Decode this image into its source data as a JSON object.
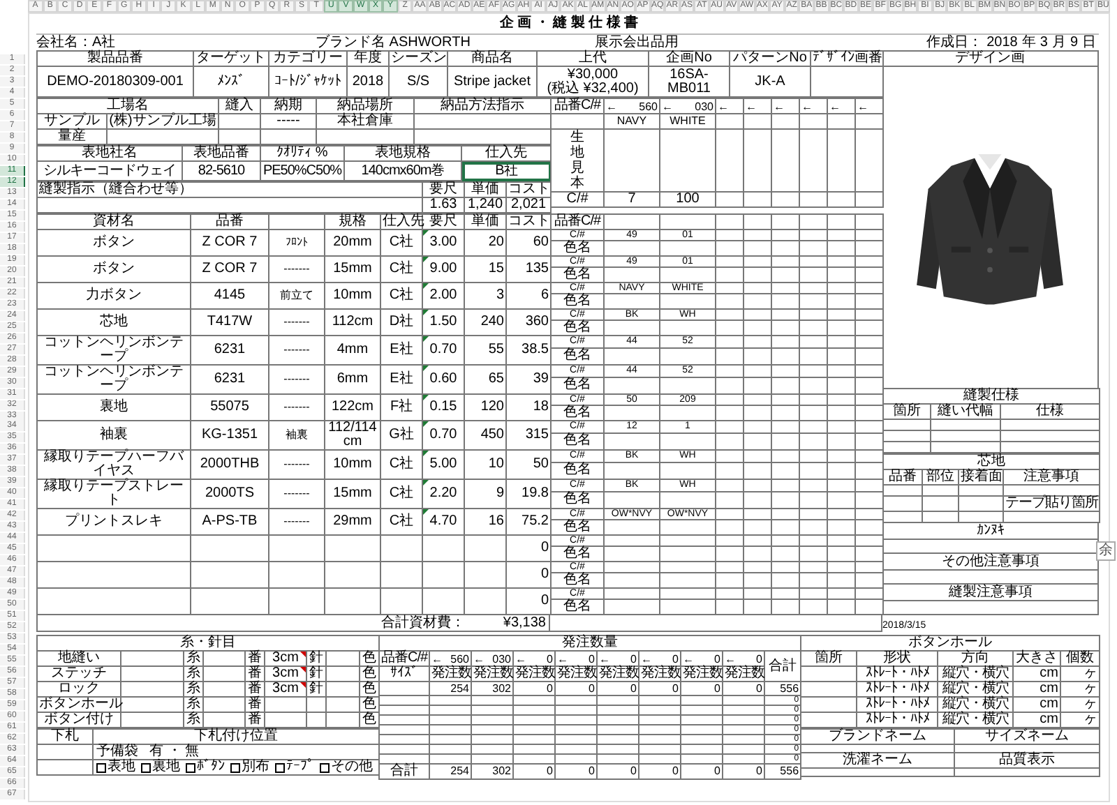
{
  "column_headers": [
    {
      "label": "A",
      "selected": false
    },
    {
      "label": "B",
      "selected": false
    },
    {
      "label": "C",
      "selected": false
    },
    {
      "label": "D",
      "selected": false
    },
    {
      "label": "E",
      "selected": false
    },
    {
      "label": "F",
      "selected": false
    },
    {
      "label": "G",
      "selected": false
    },
    {
      "label": "H",
      "selected": false
    },
    {
      "label": "I",
      "selected": false
    },
    {
      "label": "J",
      "selected": false
    },
    {
      "label": "K",
      "selected": false
    },
    {
      "label": "L",
      "selected": false
    },
    {
      "label": "M",
      "selected": false
    },
    {
      "label": "N",
      "selected": false
    },
    {
      "label": "O",
      "selected": false
    },
    {
      "label": "P",
      "selected": false
    },
    {
      "label": "Q",
      "selected": false
    },
    {
      "label": "R",
      "selected": false
    },
    {
      "label": "S",
      "selected": false
    },
    {
      "label": "T",
      "selected": false
    },
    {
      "label": "U",
      "selected": true
    },
    {
      "label": "V",
      "selected": true
    },
    {
      "label": "W",
      "selected": true
    },
    {
      "label": "X",
      "selected": true
    },
    {
      "label": "Y",
      "selected": true
    },
    {
      "label": "Z",
      "selected": false
    },
    {
      "label": "AA",
      "selected": false
    },
    {
      "label": "AB",
      "selected": false
    },
    {
      "label": "AC",
      "selected": false
    },
    {
      "label": "AD",
      "selected": false
    },
    {
      "label": "AE",
      "selected": false
    },
    {
      "label": "AF",
      "selected": false
    },
    {
      "label": "AG",
      "selected": false
    },
    {
      "label": "AH",
      "selected": false
    },
    {
      "label": "AI",
      "selected": false
    },
    {
      "label": "AJ",
      "selected": false
    },
    {
      "label": "AK",
      "selected": false
    },
    {
      "label": "AL",
      "selected": false
    },
    {
      "label": "AM",
      "selected": false
    },
    {
      "label": "AN",
      "selected": false
    },
    {
      "label": "AO",
      "selected": false
    },
    {
      "label": "AP",
      "selected": false
    },
    {
      "label": "AQ",
      "selected": false
    },
    {
      "label": "AR",
      "selected": false
    },
    {
      "label": "AS",
      "selected": false
    },
    {
      "label": "AT",
      "selected": false
    },
    {
      "label": "AU",
      "selected": false
    },
    {
      "label": "AV",
      "selected": false
    },
    {
      "label": "AW",
      "selected": false
    },
    {
      "label": "AX",
      "selected": false
    },
    {
      "label": "AY",
      "selected": false
    },
    {
      "label": "AZ",
      "selected": false
    },
    {
      "label": "BA",
      "selected": false
    },
    {
      "label": "BB",
      "selected": false
    },
    {
      "label": "BC",
      "selected": false
    },
    {
      "label": "BD",
      "selected": false
    },
    {
      "label": "BE",
      "selected": false
    },
    {
      "label": "BF",
      "selected": false
    },
    {
      "label": "BG",
      "selected": false
    },
    {
      "label": "BH",
      "selected": false
    },
    {
      "label": "BI",
      "selected": false
    },
    {
      "label": "BJ",
      "selected": false
    },
    {
      "label": "BK",
      "selected": false
    },
    {
      "label": "BL",
      "selected": false
    },
    {
      "label": "BM",
      "selected": false
    },
    {
      "label": "BN",
      "selected": false
    },
    {
      "label": "BO",
      "selected": false
    },
    {
      "label": "BP",
      "selected": false
    },
    {
      "label": "BQ",
      "selected": false
    },
    {
      "label": "BR",
      "selected": false
    },
    {
      "label": "BS",
      "selected": false
    },
    {
      "label": "BT",
      "selected": false
    },
    {
      "label": "BU",
      "selected": false
    }
  ],
  "row_headers": [
    {
      "label": "1",
      "selected": false
    },
    {
      "label": "2",
      "selected": false
    },
    {
      "label": "3",
      "selected": false
    },
    {
      "label": "4",
      "selected": false
    },
    {
      "label": "5",
      "selected": false
    },
    {
      "label": "6",
      "selected": false
    },
    {
      "label": "7",
      "selected": false
    },
    {
      "label": "8",
      "selected": false
    },
    {
      "label": "9",
      "selected": false
    },
    {
      "label": "10",
      "selected": false
    },
    {
      "label": "11",
      "selected": true
    },
    {
      "label": "12",
      "selected": true
    },
    {
      "label": "13",
      "selected": false
    },
    {
      "label": "14",
      "selected": false
    },
    {
      "label": "15",
      "selected": false
    },
    {
      "label": "16",
      "selected": false
    },
    {
      "label": "17",
      "selected": false
    },
    {
      "label": "18",
      "selected": false
    },
    {
      "label": "19",
      "selected": false
    },
    {
      "label": "20",
      "selected": false
    },
    {
      "label": "21",
      "selected": false
    },
    {
      "label": "22",
      "selected": false
    },
    {
      "label": "23",
      "selected": false
    },
    {
      "label": "24",
      "selected": false
    },
    {
      "label": "25",
      "selected": false
    },
    {
      "label": "26",
      "selected": false
    },
    {
      "label": "27",
      "selected": false
    },
    {
      "label": "28",
      "selected": false
    },
    {
      "label": "29",
      "selected": false
    },
    {
      "label": "30",
      "selected": false
    },
    {
      "label": "31",
      "selected": false
    },
    {
      "label": "32",
      "selected": false
    },
    {
      "label": "33",
      "selected": false
    },
    {
      "label": "34",
      "selected": false
    },
    {
      "label": "35",
      "selected": false
    },
    {
      "label": "36",
      "selected": false
    },
    {
      "label": "37",
      "selected": false
    },
    {
      "label": "38",
      "selected": false
    },
    {
      "label": "39",
      "selected": false
    },
    {
      "label": "40",
      "selected": false
    },
    {
      "label": "41",
      "selected": false
    },
    {
      "label": "42",
      "selected": false
    },
    {
      "label": "43",
      "selected": false
    },
    {
      "label": "44",
      "selected": false
    },
    {
      "label": "45",
      "selected": false
    },
    {
      "label": "46",
      "selected": false
    },
    {
      "label": "47",
      "selected": false
    },
    {
      "label": "48",
      "selected": false
    },
    {
      "label": "49",
      "selected": false
    },
    {
      "label": "50",
      "selected": false
    },
    {
      "label": "51",
      "selected": false
    },
    {
      "label": "52",
      "selected": false
    },
    {
      "label": "53",
      "selected": false
    },
    {
      "label": "54",
      "selected": false
    },
    {
      "label": "55",
      "selected": false
    },
    {
      "label": "56",
      "selected": false
    },
    {
      "label": "57",
      "selected": false
    },
    {
      "label": "58",
      "selected": false
    },
    {
      "label": "59",
      "selected": false
    },
    {
      "label": "60",
      "selected": false
    },
    {
      "label": "61",
      "selected": false
    },
    {
      "label": "62",
      "selected": false
    },
    {
      "label": "63",
      "selected": false
    },
    {
      "label": "64",
      "selected": false
    },
    {
      "label": "65",
      "selected": false
    },
    {
      "label": "66",
      "selected": false
    },
    {
      "label": "67",
      "selected": false
    }
  ],
  "title": "企 画 ・ 縫 製 仕 様 書",
  "company": "会社名：A社",
  "brand": "ブランド名 ASHWORTH",
  "exhibit": "展示会出品用",
  "created": {
    "label": "作成日：",
    "year": "2018",
    "year_unit": "年",
    "month": "3",
    "month_unit": "月",
    "day": "9",
    "day_unit": "日"
  },
  "product": {
    "columns": [
      "製品品番",
      "ターゲット",
      "カテゴリー",
      "年度",
      "シーズン",
      "商品名",
      "上代",
      "企画No",
      "パターンNo",
      "ﾃﾞｻﾞｲﾝ画番"
    ],
    "values": [
      "DEMO-20180309-001",
      "ﾒﾝｽﾞ",
      "ｺｰﾄ/ｼﾞｬｹｯﾄ",
      "2018",
      "S/S",
      "Stripe jacket",
      "¥30,000\n(税込 ¥32,400)",
      "16SA-MB011",
      "JK-A"
    ]
  },
  "design_label": "デザイン画",
  "factory": {
    "columns": [
      "工場名",
      "縫入",
      "納期",
      "納品場所",
      "納品方法指示"
    ],
    "rows": [
      {
        "type": "サンプル",
        "name": "(株)サンプル工場",
        "deadline": "-----",
        "place": "本社倉庫"
      },
      {
        "type": "量産"
      }
    ]
  },
  "fabric": {
    "columns": [
      "表地社名",
      "表地品番",
      "ｸｵﾘﾃｨ %",
      "表地規格",
      "仕入先"
    ],
    "cells": [
      {
        "text": "シルキーコードウェイ",
        "selected": false
      },
      {
        "text": "82-5610",
        "selected": false
      },
      {
        "text": "PE50%C50%",
        "selected": false
      },
      {
        "text": "140cmx60m巻",
        "selected": false
      },
      {
        "text": "B社",
        "selected": true
      }
    ]
  },
  "sewing_instruction": "縫製指示（縫合わせ等）",
  "cost": {
    "columns": [
      "要尺",
      "単価",
      "コスト"
    ],
    "values": [
      "1.63",
      "1,240",
      "2,021"
    ]
  },
  "colors": {
    "label": "品番C/#",
    "codes": [
      {
        "arrow": "←",
        "code": "560"
      },
      {
        "arrow": "←",
        "code": "030"
      },
      {
        "arrow": "←"
      },
      {
        "arrow": "←"
      },
      {
        "arrow": "←"
      },
      {
        "arrow": "←"
      },
      {
        "arrow": "←"
      },
      {
        "arrow": "←"
      }
    ],
    "names": [
      "NAVY",
      "WHITE"
    ],
    "sample_label": "生地見本",
    "fabric_code_label": "C/#",
    "fabric_codes": [
      "7",
      "100"
    ]
  },
  "materials": {
    "columns": [
      "資材名",
      "品番",
      "規格",
      "仕入先",
      "要尺",
      "単価",
      "コスト"
    ],
    "color_label": "品番C/#",
    "rows": [
      {
        "name": "ボタン",
        "part_no": "Z COR 7",
        "position": "ﾌﾛﾝﾄ",
        "size": "20mm",
        "supplier": "C社",
        "yield": "3.00",
        "price": "20",
        "cost": "60",
        "flagged": true,
        "code_label": "C/#",
        "name_label": "色名",
        "colors": [
          "49",
          "01"
        ]
      },
      {
        "name": "ボタン",
        "part_no": "Z COR 7",
        "position": "-------",
        "size": "15mm",
        "supplier": "C社",
        "yield": "9.00",
        "price": "15",
        "cost": "135",
        "flagged": true,
        "code_label": "C/#",
        "name_label": "色名",
        "colors": [
          "49",
          "01"
        ]
      },
      {
        "name": "力ボタン",
        "part_no": "4145",
        "position": "前立て",
        "size": "10mm",
        "supplier": "C社",
        "yield": "2.00",
        "price": "3",
        "cost": "6",
        "flagged": true,
        "code_label": "C/#",
        "name_label": "色名",
        "colors": [
          "NAVY",
          "WHITE"
        ]
      },
      {
        "name": "芯地",
        "part_no": "T417W",
        "position": "-------",
        "size": "112cm",
        "supplier": "D社",
        "yield": "1.50",
        "price": "240",
        "cost": "360",
        "flagged": true,
        "code_label": "C/#",
        "name_label": "色名",
        "colors": [
          "BK",
          "WH"
        ]
      },
      {
        "name": "コットンヘリンボンテープ",
        "part_no": "6231",
        "position": "-------",
        "size": "4mm",
        "supplier": "E社",
        "yield": "0.70",
        "price": "55",
        "cost": "38.5",
        "flagged": true,
        "code_label": "C/#",
        "name_label": "色名",
        "colors": [
          "44",
          "52"
        ]
      },
      {
        "name": "コットンヘリンボンテープ",
        "part_no": "6231",
        "position": "-------",
        "size": "6mm",
        "supplier": "E社",
        "yield": "0.60",
        "price": "65",
        "cost": "39",
        "flagged": true,
        "code_label": "C/#",
        "name_label": "色名",
        "colors": [
          "44",
          "52"
        ]
      },
      {
        "name": "裏地",
        "part_no": "55075",
        "position": "-------",
        "size": "122cm",
        "supplier": "F社",
        "yield": "0.15",
        "price": "120",
        "cost": "18",
        "flagged": true,
        "code_label": "C/#",
        "name_label": "色名",
        "colors": [
          "50",
          "209"
        ]
      },
      {
        "name": "袖裏",
        "part_no": "KG-1351",
        "position": "袖裏",
        "size": "112/114cm",
        "supplier": "G社",
        "yield": "0.70",
        "price": "450",
        "cost": "315",
        "flagged": true,
        "code_label": "C/#",
        "name_label": "色名",
        "colors": [
          "12",
          "1"
        ]
      },
      {
        "name": "縁取りテープハーフバイヤス",
        "part_no": "2000THB",
        "position": "-------",
        "size": "10mm",
        "supplier": "C社",
        "yield": "5.00",
        "price": "10",
        "cost": "50",
        "flagged": true,
        "code_label": "C/#",
        "name_label": "色名",
        "colors": [
          "BK",
          "WH"
        ]
      },
      {
        "name": "縁取りテープストレート",
        "part_no": "2000TS",
        "position": "-------",
        "size": "15mm",
        "supplier": "C社",
        "yield": "2.20",
        "price": "9",
        "cost": "19.8",
        "flagged": true,
        "code_label": "C/#",
        "name_label": "色名",
        "colors": [
          "BK",
          "WH"
        ]
      },
      {
        "name": "プリントスレキ",
        "part_no": "A-PS-TB",
        "position": "-------",
        "size": "29mm",
        "supplier": "C社",
        "yield": "4.70",
        "price": "16",
        "cost": "75.2",
        "flagged": true,
        "code_label": "C/#",
        "name_label": "色名",
        "colors": [
          "OW*NVY",
          "OW*NVY"
        ]
      },
      {
        "cost": "0",
        "flagged": false,
        "code_label": "C/#",
        "name_label": "色名"
      },
      {
        "cost": "0",
        "flagged": false,
        "code_label": "C/#",
        "name_label": "色名"
      },
      {
        "cost": "0",
        "flagged": false,
        "code_label": "C/#",
        "name_label": "色名"
      }
    ]
  },
  "materials_total": {
    "label": "合計資材費：",
    "value": "¥3,138"
  },
  "thread": {
    "title": "糸・針目",
    "rows": [
      {
        "name": "地縫い",
        "thread": "糸",
        "number": "番",
        "pitch": "3cm",
        "needle": "針",
        "color_label": "色",
        "flagged": true
      },
      {
        "name": "ステッチ",
        "thread": "糸",
        "number": "番",
        "pitch": "3cm",
        "needle": "針",
        "color_label": "色",
        "flagged": true
      },
      {
        "name": "ロック",
        "thread": "糸",
        "number": "番",
        "pitch": "3cm",
        "needle": "針",
        "color_label": "色",
        "flagged": true
      },
      {
        "name": "ボタンホール",
        "thread": "糸",
        "number": "番",
        "color_label": "色",
        "flagged": false
      },
      {
        "name": "ボタン付け",
        "thread": "糸",
        "number": "番",
        "color_label": "色",
        "flagged": false
      }
    ]
  },
  "tag": {
    "label": "下札",
    "position_label": "下札付け位置",
    "spare_label": "予備袋",
    "spare_value": "有 ・ 無",
    "options": [
      {
        "label": "表地",
        "checked": false
      },
      {
        "label": "裏地",
        "checked": false
      },
      {
        "label": "ﾎﾞﾀﾝ",
        "checked": false
      },
      {
        "label": "別布",
        "checked": false
      },
      {
        "label": "ﾃｰﾌﾟ",
        "checked": false
      },
      {
        "label": "その他",
        "checked": false
      }
    ]
  },
  "buttonhole": {
    "title": "ボタンホール",
    "columns": [
      "箇所",
      "形状",
      "方向",
      "大きさ",
      "個数"
    ],
    "rows": [
      {
        "shape": "ｽﾄﾚｰﾄ・ﾊﾄﾒ",
        "direction": "縦穴・横穴",
        "unit": "cm",
        "count_unit": "ヶ"
      },
      {
        "shape": "ｽﾄﾚｰﾄ・ﾊﾄﾒ",
        "direction": "縦穴・横穴",
        "unit": "cm",
        "count_unit": "ヶ"
      },
      {
        "shape": "ｽﾄﾚｰﾄ・ﾊﾄﾒ",
        "direction": "縦穴・横穴",
        "unit": "cm",
        "count_unit": "ヶ"
      },
      {
        "shape": "ｽﾄﾚｰﾄ・ﾊﾄﾒ",
        "direction": "縦穴・横穴",
        "unit": "cm",
        "count_unit": "ヶ"
      }
    ]
  },
  "names": [
    "ブランドネーム",
    "サイズネーム",
    "洗濯ネーム",
    "品質表示"
  ],
  "order": {
    "title": "発注数量",
    "code_label": "品番C/#",
    "size_label": "ｻｲｽﾞ",
    "total_label": "合計",
    "codes": [
      {
        "arrow": "←",
        "code": "560"
      },
      {
        "arrow": "←",
        "code": "030"
      },
      {
        "arrow": "←",
        "code": "0"
      },
      {
        "arrow": "←",
        "code": "0"
      },
      {
        "arrow": "←",
        "code": "0"
      },
      {
        "arrow": "←",
        "code": "0"
      },
      {
        "arrow": "←",
        "code": "0"
      },
      {
        "arrow": "←",
        "code": "0"
      }
    ],
    "qty_labels": [
      "発注数",
      "発注数",
      "発注数",
      "発注数",
      "発注数",
      "発注数",
      "発注数",
      "発注数"
    ],
    "rows": [
      {
        "values": [
          "254",
          "302",
          "0",
          "0",
          "0",
          "0",
          "0",
          "0"
        ],
        "total": "556"
      },
      {
        "total": "0"
      },
      {
        "total": "0"
      },
      {
        "total": "0"
      },
      {
        "total": "0"
      },
      {
        "total": "0"
      },
      {
        "total": "0"
      },
      {
        "total": "0"
      }
    ],
    "sum_label": "合計",
    "sums": [
      "254",
      "302",
      "0",
      "0",
      "0",
      "0",
      "0",
      "0"
    ],
    "sum_total": "556"
  },
  "sewing_spec": {
    "title": "縫製仕様",
    "columns": [
      "箇所",
      "縫い代幅",
      "仕様"
    ]
  },
  "interlining": {
    "title": "芯地",
    "columns": [
      "品番",
      "部位",
      "接着面",
      "注意事項"
    ],
    "tape_label": "テープ貼り箇所"
  },
  "kanuki": "ｶﾝﾇｷ",
  "other_notes": "その他注意事項",
  "sewing_notes": "縫製注意事項",
  "footer_date": "2018/3/15",
  "side_tab": "余"
}
